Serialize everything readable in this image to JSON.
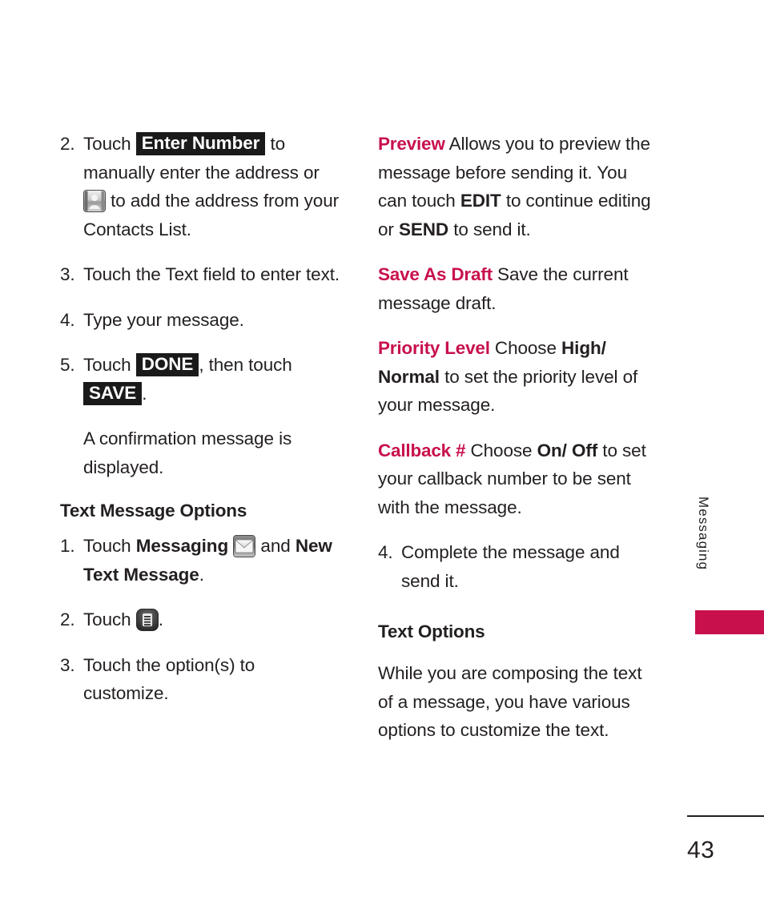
{
  "page": {
    "number": "43",
    "side_tab_label": "Messaging",
    "accent_color": "#c8104c",
    "text_color": "#231f20"
  },
  "left_column": {
    "steps": [
      {
        "num": "2.",
        "pre": "Touch",
        "key": "Enter Number",
        "mid": "to manually enter the address or",
        "icon": "contacts-book-icon",
        "post": "to add the address from your Contacts List."
      },
      {
        "num": "3.",
        "text": "Touch the Text field to enter text."
      },
      {
        "num": "4.",
        "text": "Type your message."
      },
      {
        "num": "5.",
        "pre": "Touch",
        "key1": "DONE",
        "mid": ", then touch",
        "key2": "SAVE",
        "post": "."
      }
    ],
    "note": "A confirmation message is displayed.",
    "section_heading": "Text Message Options",
    "option_steps": [
      {
        "num": "1.",
        "pre": "Touch",
        "bold1": "Messaging",
        "icon": "envelope-icon",
        "mid": "and",
        "bold2": "New Text Message",
        "post": "."
      },
      {
        "num": "2.",
        "pre": "Touch",
        "icon": "options-list-icon",
        "post": "."
      },
      {
        "num": "3.",
        "text": "Touch the option(s) to customize."
      }
    ]
  },
  "right_column": {
    "definitions": [
      {
        "term": "Preview",
        "parts": [
          {
            "type": "plain",
            "text": " Allows you to preview the message before sending it. You can touch "
          },
          {
            "type": "bold",
            "text": "EDIT"
          },
          {
            "type": "plain",
            "text": " to continue editing or "
          },
          {
            "type": "bold",
            "text": "SEND"
          },
          {
            "type": "plain",
            "text": " to send it."
          }
        ]
      },
      {
        "term": "Save As Draft",
        "parts": [
          {
            "type": "plain",
            "text": " Save the current message draft."
          }
        ]
      },
      {
        "term": "Priority Level",
        "parts": [
          {
            "type": "plain",
            "text": " Choose "
          },
          {
            "type": "bold",
            "text": "High/ Normal"
          },
          {
            "type": "plain",
            "text": " to set the priority level of your message."
          }
        ]
      },
      {
        "term": "Callback #",
        "parts": [
          {
            "type": "plain",
            "text": " Choose "
          },
          {
            "type": "bold",
            "text": "On/ Off"
          },
          {
            "type": "plain",
            "text": " to set your callback number to be sent with the message."
          }
        ]
      }
    ],
    "step": {
      "num": "4.",
      "text": "Complete the message and send it."
    },
    "section_heading": "Text Options",
    "body": "While you are composing the text of a message, you have various options to customize the text."
  }
}
